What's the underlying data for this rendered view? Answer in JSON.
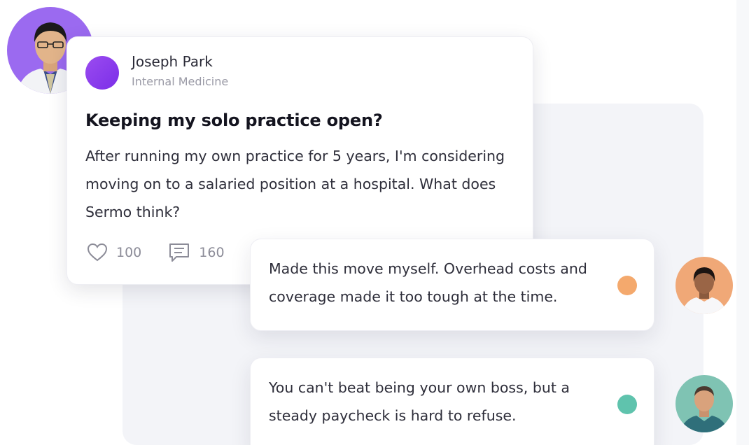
{
  "post": {
    "author_name": "Joseph Park",
    "author_role": "Internal Medicine",
    "title": "Keeping my solo practice open?",
    "body": "After running my own practice for 5 years, I'm considering moving on to a salaried position at a hospital. What does Sermo think?",
    "likes": "100",
    "comments": "160",
    "author_dot_color": "#8b3cf0"
  },
  "replies": [
    {
      "text": "Made this move myself. Overhead costs and coverage made it too tough at the time.",
      "dot_color": "#f4a96d"
    },
    {
      "text": "You can't beat being your own boss, but a steady paycheck is hard to refuse.",
      "dot_color": "#5fc3ad"
    }
  ],
  "icons": {
    "like": "heart-outline-icon",
    "comment": "comment-lines-icon"
  }
}
